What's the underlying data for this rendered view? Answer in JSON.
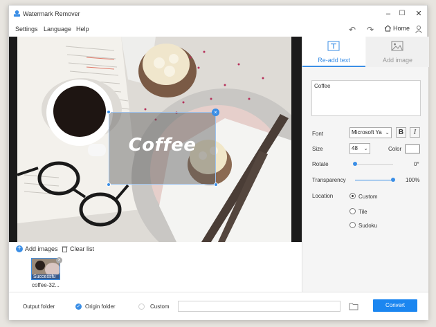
{
  "window": {
    "title": "Watermark Remover",
    "controls": {
      "minimize": "–",
      "maximize": "☐",
      "close": "✕"
    }
  },
  "menu": {
    "items": [
      "Settings",
      "Language",
      "Help"
    ],
    "home_label": "Home"
  },
  "canvas": {
    "watermark_text": "Coffee",
    "close_glyph": "×"
  },
  "file_list": {
    "add_images_label": "Add images",
    "clear_list_label": "Clear list",
    "thumbnails": [
      {
        "name": "coffee-32...",
        "status": "Successfu"
      }
    ]
  },
  "right_panel": {
    "tabs": [
      {
        "label": "Re-add text",
        "active": true
      },
      {
        "label": "Add image",
        "active": false
      }
    ],
    "text_value": "Coffee",
    "font": {
      "label": "Font",
      "value": "Microsoft Ya",
      "bold": "B",
      "italic": "I"
    },
    "size": {
      "label": "Size",
      "value": "48"
    },
    "color": {
      "label": "Color",
      "value": "#ffffff"
    },
    "rotate": {
      "label": "Rotate",
      "value": "0°",
      "fraction": 0.0
    },
    "transparency": {
      "label": "Transparency",
      "value": "100%",
      "fraction": 1.0
    },
    "location": {
      "label": "Location",
      "options": [
        {
          "label": "Custom",
          "checked": true
        },
        {
          "label": "Tile",
          "checked": false
        },
        {
          "label": "Sudoku",
          "checked": false
        }
      ]
    }
  },
  "footer": {
    "output_folder_label": "Output folder",
    "origin_folder_label": "Origin folder",
    "custom_label": "Custom",
    "path_value": "",
    "convert_label": "Convert"
  },
  "colors": {
    "accent": "#3a8ee6",
    "convert_button": "#1b86f0"
  }
}
